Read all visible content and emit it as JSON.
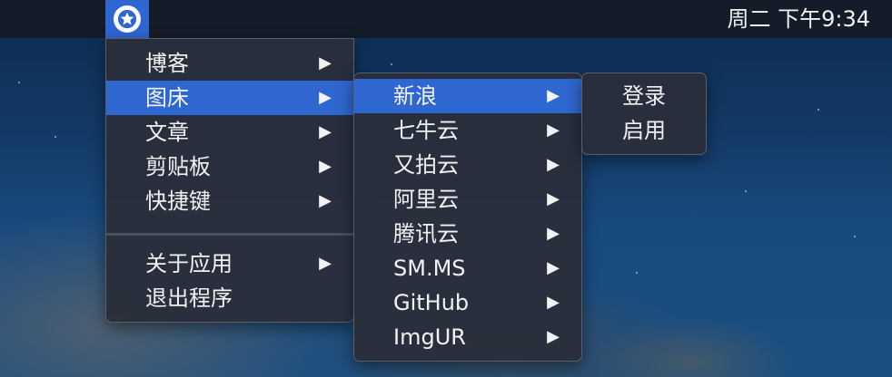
{
  "menubar": {
    "clock": "周二 下午9:34",
    "status_icon": "star-circle-icon"
  },
  "main_menu": {
    "items": [
      {
        "label": "博客",
        "arrow": "▶"
      },
      {
        "label": "图床",
        "arrow": "▶",
        "highlighted": true
      },
      {
        "label": "文章",
        "arrow": "▶"
      },
      {
        "label": "剪贴板",
        "arrow": "▶"
      },
      {
        "label": "快捷键",
        "arrow": "▶"
      }
    ],
    "items_after_separator": [
      {
        "label": "关于应用",
        "arrow": "▶"
      },
      {
        "label": "退出程序"
      }
    ]
  },
  "hosts_menu": {
    "items": [
      {
        "label": "新浪",
        "arrow": "▶",
        "highlighted": true
      },
      {
        "label": "七牛云",
        "arrow": "▶"
      },
      {
        "label": "又拍云",
        "arrow": "▶"
      },
      {
        "label": "阿里云",
        "arrow": "▶"
      },
      {
        "label": "腾讯云",
        "arrow": "▶"
      },
      {
        "label": "SM.MS",
        "arrow": "▶"
      },
      {
        "label": "GitHub",
        "arrow": "▶"
      },
      {
        "label": "ImgUR",
        "arrow": "▶"
      }
    ]
  },
  "sina_menu": {
    "items": [
      {
        "label": "登录"
      },
      {
        "label": "启用"
      }
    ]
  },
  "colors": {
    "highlight": "#2f67d0",
    "menu_bg": "#2a2e3a",
    "menubar_bg": "#131c28"
  }
}
